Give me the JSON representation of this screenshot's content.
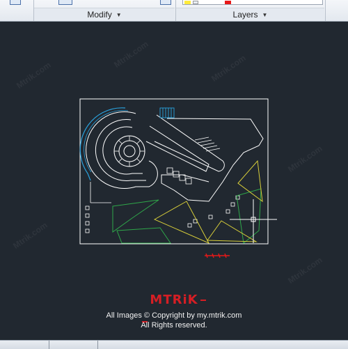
{
  "ribbon": {
    "modify_label": "Modify",
    "layers_label": "Layers",
    "dropdown_glyph": "▼",
    "layer_color_active": "#e81818"
  },
  "drawing": {
    "line_color": "#ffffff",
    "stair_color": "#2aa3df",
    "green_color": "#2fa84a",
    "yellow_color": "#d9cf3a",
    "red_color": "#e81818"
  },
  "watermark_text": "Mtrik.com",
  "footer": {
    "logo_text": "MTRiK",
    "copyright_line": "All Images © Copyright by my.mtrik.com",
    "rights_line": "All Rights reserved."
  }
}
